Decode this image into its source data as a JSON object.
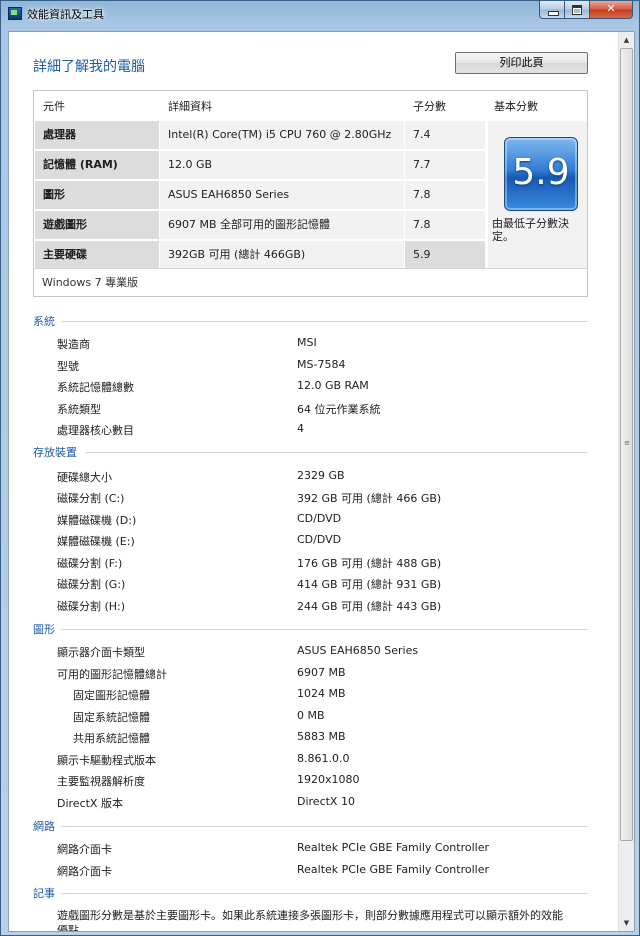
{
  "window": {
    "title": "效能資訊及工具"
  },
  "header": {
    "heading": "詳細了解我的電腦",
    "print_label": "列印此頁"
  },
  "scores": {
    "columns": [
      "元件",
      "詳細資料",
      "子分數",
      "基本分數"
    ],
    "rows": [
      {
        "component": "處理器",
        "details": "Intel(R) Core(TM) i5 CPU 760 @ 2.80GHz",
        "subscore": "7.4"
      },
      {
        "component": "記憶體 (RAM)",
        "details": "12.0 GB",
        "subscore": "7.7"
      },
      {
        "component": "圖形",
        "details": "ASUS EAH6850 Series",
        "subscore": "7.8"
      },
      {
        "component": "遊戲圖形",
        "details": "6907 MB 全部可用的圖形記憶體",
        "subscore": "7.8"
      },
      {
        "component": "主要硬碟",
        "details": "392GB 可用 (總計 466GB)",
        "subscore": "5.9"
      }
    ],
    "base_score": "5.9",
    "base_caption": "由最低子分數決定。",
    "edition": "Windows 7 專業版",
    "badge_color": "#2f7cd4"
  },
  "system": {
    "title": "系統",
    "items": [
      {
        "label": "製造商",
        "value": "MSI"
      },
      {
        "label": "型號",
        "value": "MS-7584"
      },
      {
        "label": "系統記憶體總數",
        "value": "12.0 GB RAM"
      },
      {
        "label": "系統類型",
        "value": "64 位元作業系統"
      },
      {
        "label": "處理器核心數目",
        "value": "4"
      }
    ]
  },
  "storage": {
    "title": "存放裝置",
    "items": [
      {
        "label": "硬碟總大小",
        "value": "2329 GB"
      },
      {
        "label": "磁碟分割 (C:)",
        "value": "392 GB 可用 (總計 466 GB)"
      },
      {
        "label": "媒體磁碟機 (D:)",
        "value": "CD/DVD"
      },
      {
        "label": "媒體磁碟機 (E:)",
        "value": "CD/DVD"
      },
      {
        "label": "磁碟分割 (F:)",
        "value": "176 GB 可用 (總計 488 GB)"
      },
      {
        "label": "磁碟分割 (G:)",
        "value": "414 GB 可用 (總計 931 GB)"
      },
      {
        "label": "磁碟分割 (H:)",
        "value": "244 GB 可用 (總計 443 GB)"
      }
    ]
  },
  "graphics": {
    "title": "圖形",
    "items": [
      {
        "label": "顯示器介面卡類型",
        "value": "ASUS EAH6850 Series"
      },
      {
        "label": "可用的圖形記憶體總計",
        "value": "6907 MB"
      },
      {
        "label": "固定圖形記憶體",
        "value": "1024 MB"
      },
      {
        "label": "固定系統記憶體",
        "value": "0 MB"
      },
      {
        "label": "共用系統記憶體",
        "value": "5883 MB"
      },
      {
        "label": "顯示卡驅動程式版本",
        "value": "8.861.0.0"
      },
      {
        "label": "主要監視器解析度",
        "value": "1920x1080"
      },
      {
        "label": "DirectX 版本",
        "value": "DirectX 10"
      }
    ]
  },
  "network": {
    "title": "網路",
    "items": [
      {
        "label": "網路介面卡",
        "value": "Realtek PCIe GBE Family Controller"
      },
      {
        "label": "網路介面卡",
        "value": "Realtek PCIe GBE Family Controller"
      }
    ]
  },
  "notes": {
    "title": "記事",
    "text": "遊戲圖形分數是基於主要圖形卡。如果此系統連接多張圖形卡，則部分數據應用程式可以顯示額外的效能優點。"
  }
}
